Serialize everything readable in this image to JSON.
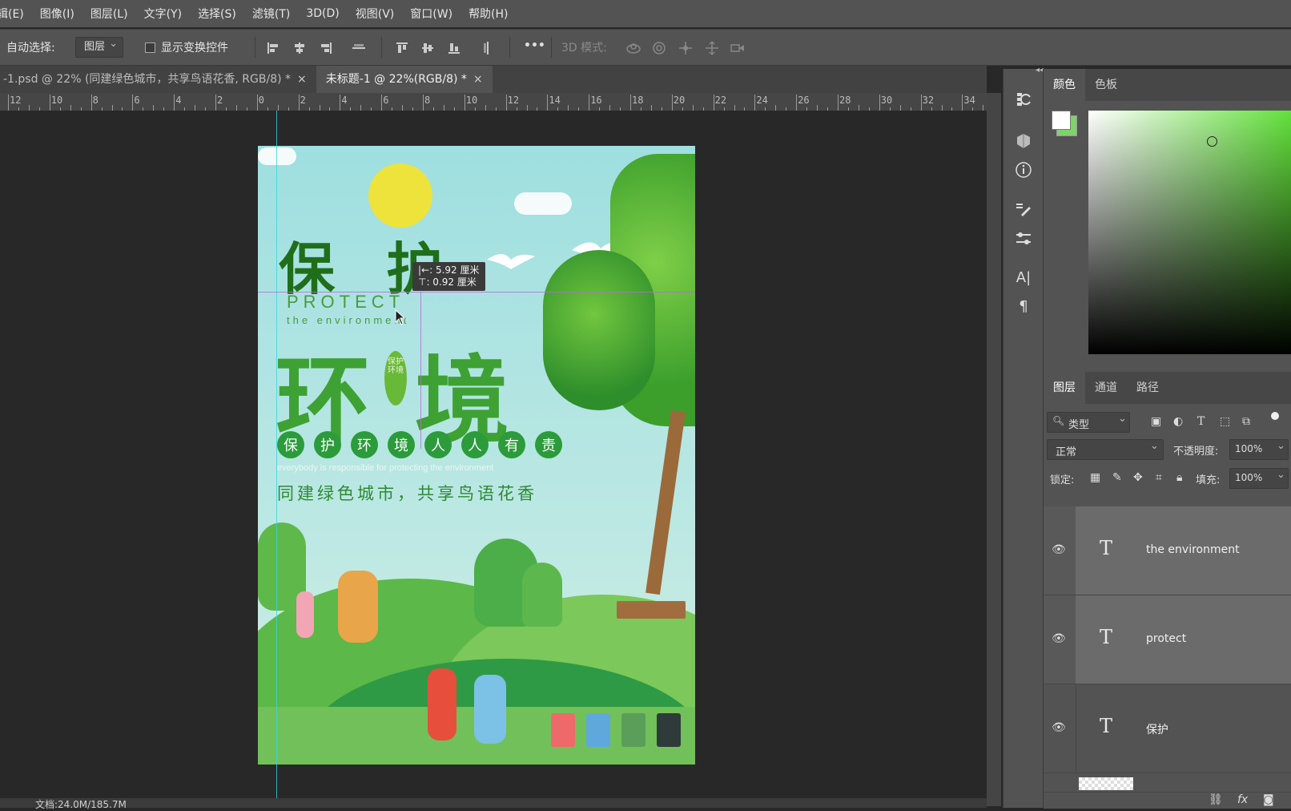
{
  "menubar": {
    "items": [
      "辑(E)",
      "图像(I)",
      "图层(L)",
      "文字(Y)",
      "选择(S)",
      "滤镜(T)",
      "3D(D)",
      "视图(V)",
      "窗口(W)",
      "帮助(H)"
    ]
  },
  "options_bar": {
    "auto_select_label": "自动选择:",
    "auto_select_value": "图层",
    "show_transform_label": "显示变换控件",
    "mode_3d_label": "3D 模式:",
    "more_icon": "•••"
  },
  "doc_tabs": [
    {
      "label": "-1.psd @ 22% (同建绿色城市，共享鸟语花香, RGB/8) *",
      "close": "×"
    },
    {
      "label": "未标题-1 @ 22%(RGB/8) *",
      "close": "×"
    }
  ],
  "ruler": {
    "labels": [
      "12",
      "10",
      "8",
      "6",
      "4",
      "2",
      "0",
      "2",
      "4",
      "6",
      "8",
      "10",
      "12",
      "14",
      "16",
      "18",
      "20",
      "22",
      "24",
      "26",
      "28",
      "30",
      "32",
      "34"
    ]
  },
  "measure_tooltip": {
    "line1": "|←: 5.92 厘米",
    "line2": "⊤: 0.92 厘米"
  },
  "poster": {
    "title_top": "保 护",
    "protect_en": "PROTECT",
    "environment_en": "the environment",
    "title_main_left": "环",
    "title_main_right": "境",
    "leaf_text": "保护环境",
    "circle_chars": [
      "保",
      "护",
      "环",
      "境",
      "人",
      "人",
      "有",
      "责"
    ],
    "slogan_en": "everybody is responsible for protecting the environment",
    "slogan_cn": "同建绿色城市，共享鸟语花香"
  },
  "status": {
    "text": "文档:24.0M/185.7M"
  },
  "color_panel": {
    "tabs": [
      "颜色",
      "色板"
    ],
    "foreground": "#ffffff",
    "background": "#7ed36a",
    "hue": "#62e13a"
  },
  "layers_panel": {
    "tabs": [
      "图层",
      "通道",
      "路径"
    ],
    "filter_label": "类型",
    "blend_mode": "正常",
    "opacity_label": "不透明度:",
    "opacity_value": "100%",
    "lock_label": "锁定:",
    "fill_label": "填充:",
    "fill_value": "100%",
    "layers": [
      {
        "name": "the environment",
        "type_icon": "T"
      },
      {
        "name": "protect",
        "type_icon": "T"
      },
      {
        "name": "保护",
        "type_icon": "T"
      }
    ],
    "footer_icons": [
      "link-icon",
      "fx-icon",
      "mask-icon"
    ],
    "footer_fx": "fx"
  }
}
